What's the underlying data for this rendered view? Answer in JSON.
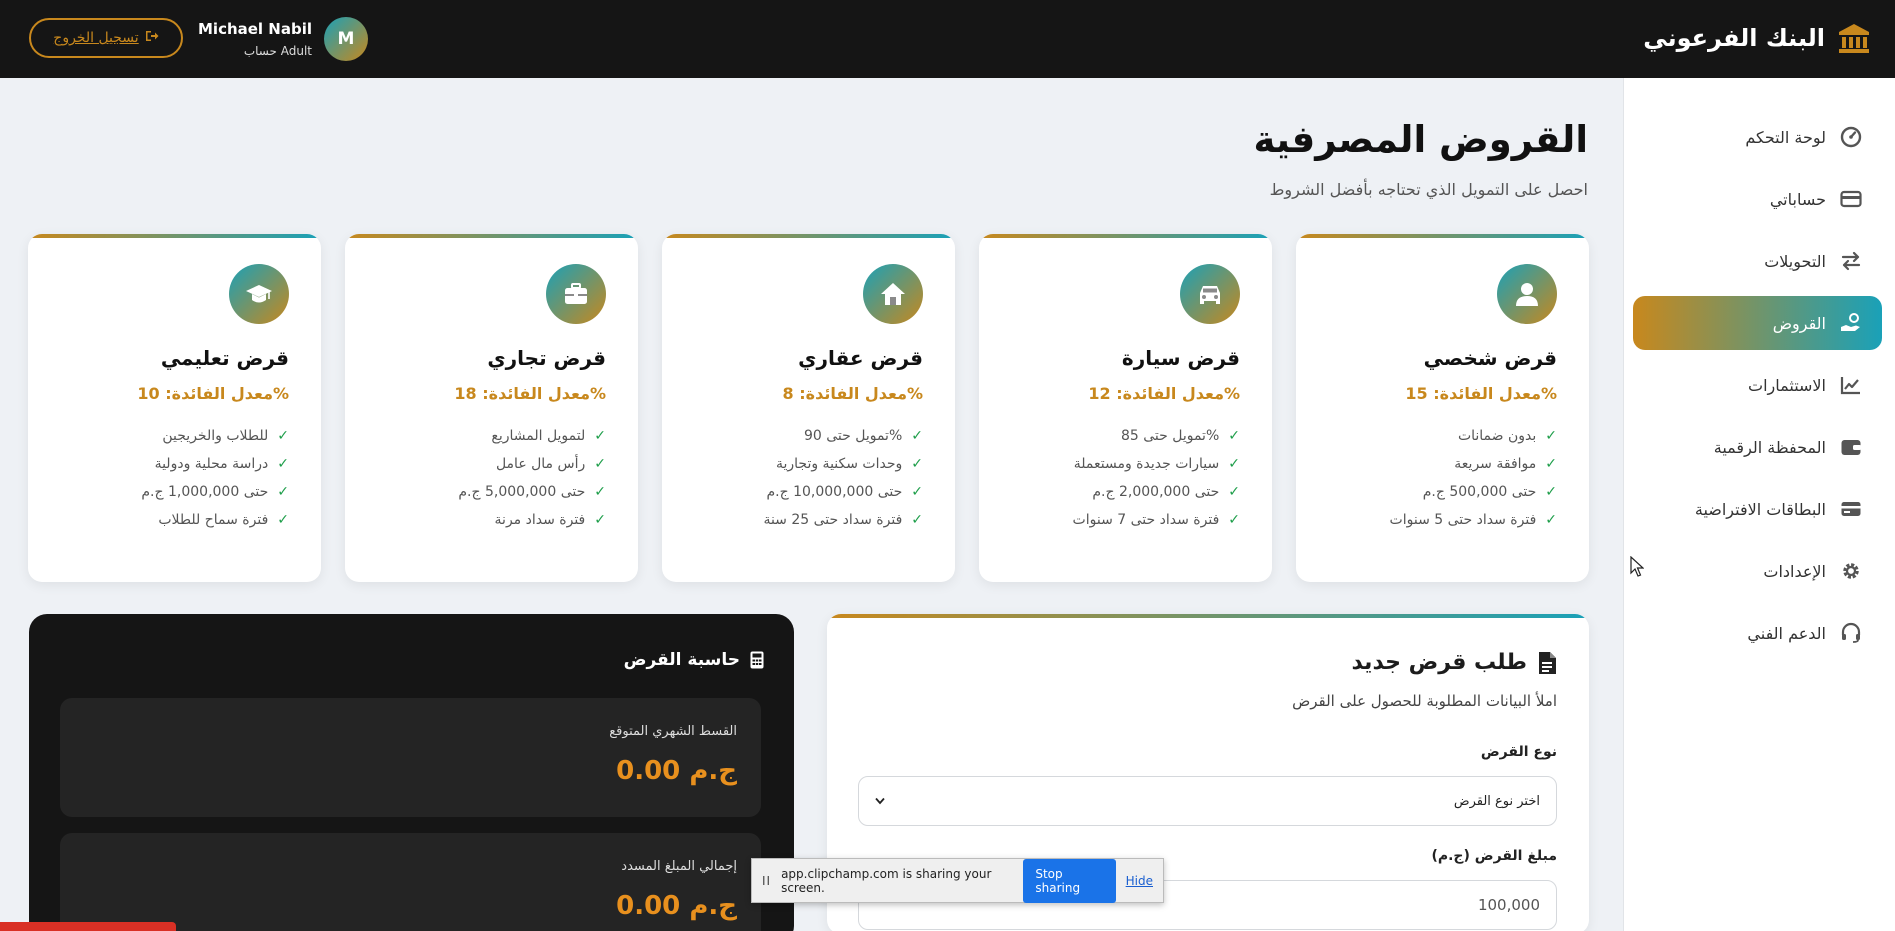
{
  "header": {
    "brand": "البنك الفرعوني",
    "brand_icon": "bank-icon",
    "user_name": "Michael Nabil",
    "user_sub": "حساب Adult",
    "avatar_letter": "M",
    "logout_label": "تسجيل الخروج",
    "logout_icon": "logout-icon"
  },
  "sidebar": {
    "items": [
      {
        "label": "لوحة التحكم",
        "icon": "gauge-icon",
        "active": false
      },
      {
        "label": "حساباتي",
        "icon": "credit-card-icon",
        "active": false
      },
      {
        "label": "التحويلات",
        "icon": "transfer-icon",
        "active": false
      },
      {
        "label": "القروض",
        "icon": "hand-holding-money-icon",
        "active": true
      },
      {
        "label": "الاستثمارات",
        "icon": "chart-line-icon",
        "active": false
      },
      {
        "label": "المحفظة الرقمية",
        "icon": "wallet-icon",
        "active": false
      },
      {
        "label": "البطاقات الافتراضية",
        "icon": "card-icon",
        "active": false
      },
      {
        "label": "الإعدادات",
        "icon": "gear-icon",
        "active": false
      },
      {
        "label": "الدعم الفني",
        "icon": "headset-icon",
        "active": false
      }
    ]
  },
  "page": {
    "title": "القروض المصرفية",
    "subtitle": "احصل على التمويل الذي تحتاجه بأفضل الشروط"
  },
  "loans": [
    {
      "name": "قرض شخصي",
      "rate": "معدل الفائدة: 15%",
      "icon": "user-icon",
      "features": [
        "بدون ضمانات",
        "موافقة سريعة",
        "حتى 500,000 ج.م",
        "فترة سداد حتى 5 سنوات"
      ]
    },
    {
      "name": "قرض سيارة",
      "rate": "معدل الفائدة: 12%",
      "icon": "car-icon",
      "features": [
        "تمويل حتى 85%",
        "سيارات جديدة ومستعملة",
        "حتى 2,000,000 ج.م",
        "فترة سداد حتى 7 سنوات"
      ]
    },
    {
      "name": "قرض عقاري",
      "rate": "معدل الفائدة: 8%",
      "icon": "home-icon",
      "features": [
        "تمويل حتى 90%",
        "وحدات سكنية وتجارية",
        "حتى 10,000,000 ج.م",
        "فترة سداد حتى 25 سنة"
      ]
    },
    {
      "name": "قرض تجاري",
      "rate": "معدل الفائدة: 18%",
      "icon": "briefcase-icon",
      "features": [
        "لتمويل المشاريع",
        "رأس مال عامل",
        "حتى 5,000,000 ج.م",
        "فترة سداد مرنة"
      ]
    },
    {
      "name": "قرض تعليمي",
      "rate": "معدل الفائدة: 10%",
      "icon": "graduation-cap-icon",
      "features": [
        "للطلاب والخريجين",
        "دراسة محلية ودولية",
        "حتى 1,000,000 ج.م",
        "فترة سماح للطلاب"
      ]
    }
  ],
  "form": {
    "title": "طلب قرض جديد",
    "subtitle": "املأ البيانات المطلوبة للحصول على القرض",
    "type_label": "نوع القرض",
    "type_value": "اختر نوع القرض",
    "amount_label": "مبلغ القرض (ج.م)",
    "amount_value": "100,000"
  },
  "calculator": {
    "title": "حاسبة القرض",
    "monthly_label": "القسط الشهري المتوقع",
    "monthly_value": "0.00 ج.م",
    "total_label": "إجمالي المبلغ المسدد",
    "total_value": "0.00 ج.م"
  },
  "share": {
    "message": "app.clipchamp.com is sharing your screen.",
    "stop_label": "Stop sharing",
    "hide_label": "Hide"
  },
  "colors": {
    "accent_gold": "#c8881d",
    "accent_teal": "#1aa1b8",
    "check_green": "#1e9e4a"
  }
}
